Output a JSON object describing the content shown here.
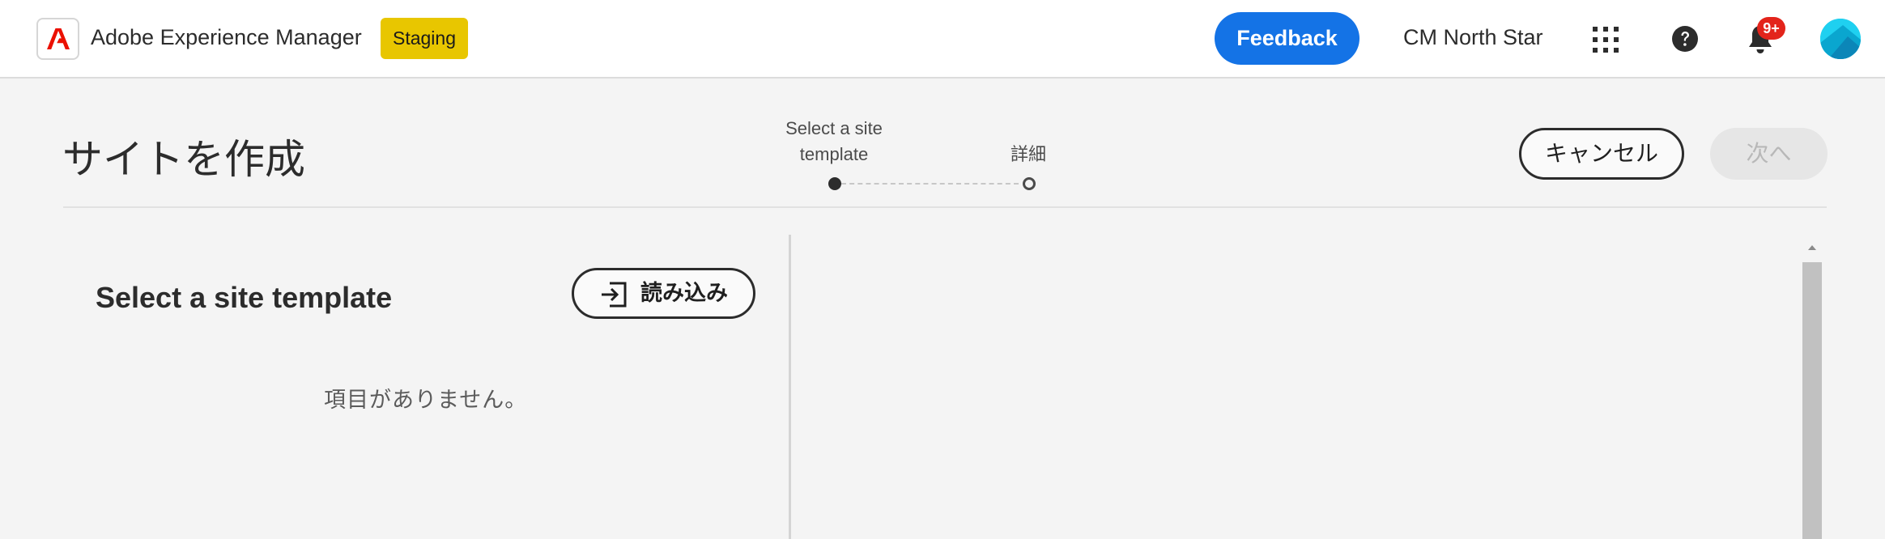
{
  "shell": {
    "app_title": "Adobe Experience Manager",
    "environment_badge": "Staging",
    "feedback_label": "Feedback",
    "org_name": "CM North Star",
    "notification_count": "9+",
    "icons": [
      "adobe-logo-icon",
      "apps-grid-icon",
      "help-icon",
      "bell-icon",
      "avatar"
    ],
    "colors": {
      "accent": "#1473e6",
      "badge": "#e8c600",
      "alert": "#e3241b",
      "logo_red": "#eb1000"
    }
  },
  "wizard": {
    "title": "サイトを作成",
    "steps": [
      {
        "label_line1": "Select a site",
        "label_line2": "template",
        "state": "current"
      },
      {
        "label_line1": "",
        "label_line2": "詳細",
        "state": "upcoming"
      }
    ],
    "cancel_label": "キャンセル",
    "next_label": "次へ",
    "next_enabled": false
  },
  "left_panel": {
    "title": "Select a site template",
    "import_label": "読み込み",
    "empty_message": "項目がありません。"
  }
}
